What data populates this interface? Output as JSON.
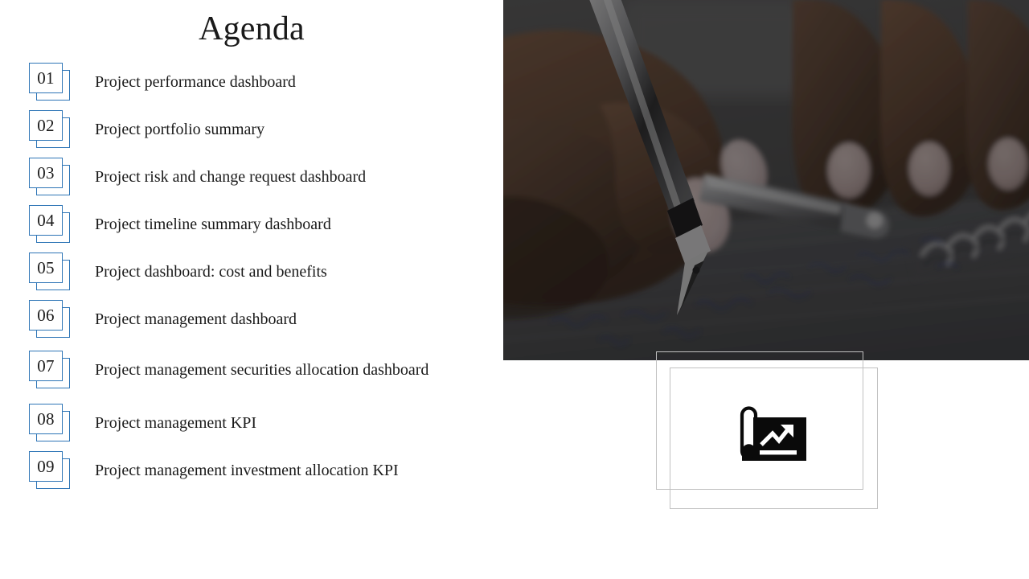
{
  "slide": {
    "title": "Agenda",
    "background_color": "#ffffff",
    "accent_color": "#2e75b6",
    "text_color": "#1a1a1a",
    "frame_border_color": "#c0c0c0"
  },
  "agenda": {
    "items": [
      {
        "number": "01",
        "label": "Project performance dashboard"
      },
      {
        "number": "02",
        "label": "Project portfolio summary"
      },
      {
        "number": "03",
        "label": "Project risk and change request dashboard"
      },
      {
        "number": "04",
        "label": "Project timeline summary dashboard"
      },
      {
        "number": "05",
        "label": "Project dashboard: cost and benefits"
      },
      {
        "number": "06",
        "label": "Project management dashboard"
      },
      {
        "number": "07",
        "label": "Project management securities allocation dashboard"
      },
      {
        "number": "08",
        "label": "Project management KPI"
      },
      {
        "number": "09",
        "label": "Project management investment allocation KPI"
      }
    ]
  },
  "media": {
    "photo_alt": "hand-writing-with-fountain-pen-on-spiral-notebook",
    "icon_alt": "rolled-blueprint-chart-icon"
  }
}
